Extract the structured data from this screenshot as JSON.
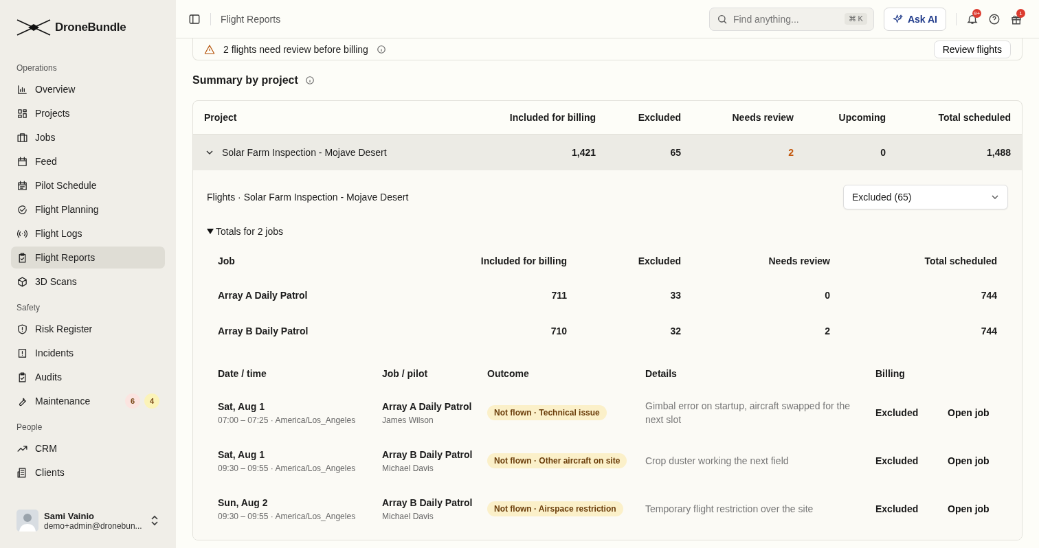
{
  "brand": {
    "name": "DroneBundle"
  },
  "sidebar": {
    "sections": [
      {
        "title": "Operations",
        "items": [
          {
            "label": "Overview",
            "selected": false
          },
          {
            "label": "Projects",
            "selected": false
          },
          {
            "label": "Jobs",
            "selected": false
          },
          {
            "label": "Feed",
            "selected": false
          },
          {
            "label": "Pilot Schedule",
            "selected": false
          },
          {
            "label": "Flight Planning",
            "selected": false
          },
          {
            "label": "Flight Logs",
            "selected": false
          },
          {
            "label": "Flight Reports",
            "selected": true
          },
          {
            "label": "3D Scans",
            "selected": false
          }
        ]
      },
      {
        "title": "Safety",
        "items": [
          {
            "label": "Risk Register",
            "selected": false
          },
          {
            "label": "Incidents",
            "selected": false
          },
          {
            "label": "Audits",
            "selected": false
          },
          {
            "label": "Maintenance",
            "selected": false,
            "badges": [
              {
                "text": "6",
                "color": "#fbe4e0"
              },
              {
                "text": "4",
                "color": "#fbf3b8"
              }
            ]
          }
        ]
      },
      {
        "title": "People",
        "items": [
          {
            "label": "CRM",
            "selected": false
          },
          {
            "label": "Clients",
            "selected": false
          }
        ]
      }
    ],
    "user": {
      "name": "Sami Vainio",
      "email": "demo+admin@dronebun..."
    }
  },
  "topbar": {
    "breadcrumb": "Flight Reports",
    "search": {
      "placeholder": "Find anything...",
      "shortcut": "⌘ K"
    },
    "ask_button": "Ask AI",
    "notifications_badge": "9+",
    "gift_badge": "1"
  },
  "alert": {
    "text": "2 flights need review before billing",
    "button": "Review flights"
  },
  "summary": {
    "title": "Summary by project",
    "columns": [
      "Project",
      "Included for billing",
      "Excluded",
      "Needs review",
      "Upcoming",
      "Total scheduled"
    ],
    "rows": [
      {
        "expanded": true,
        "cells": [
          {
            "text": "Solar Farm Inspection - Mojave Desert",
            "attention": false
          },
          {
            "text": "1,421",
            "attention": false
          },
          {
            "text": "65",
            "attention": false
          },
          {
            "text": "2",
            "attention": true
          },
          {
            "text": "0",
            "attention": false
          },
          {
            "text": "1,488",
            "attention": false
          }
        ]
      }
    ]
  },
  "flights_panel": {
    "title": "Flights · Solar Farm Inspection - Mojave Desert",
    "filter": "Excluded (65)",
    "totals": {
      "label": "Totals for 2 jobs",
      "expanded": true,
      "columns": [
        "Job",
        "Included for billing",
        "Excluded",
        "Needs review",
        "Total scheduled"
      ],
      "rows": [
        [
          "Array A Daily Patrol",
          "711",
          "33",
          "0",
          "744"
        ],
        [
          "Array B Daily Patrol",
          "710",
          "32",
          "2",
          "744"
        ]
      ]
    },
    "columns": [
      "Date / time",
      "Job / pilot",
      "Outcome",
      "Details",
      "Billing"
    ],
    "rows": [
      {
        "date": "Sat, Aug 1",
        "time": "07:00 – 07:25 · America/Los_Angeles",
        "job": "Array A Daily Patrol",
        "pilot": "James Wilson",
        "outcome": "Not flown · Technical issue",
        "details": "Gimbal error on startup, aircraft swapped for the next slot",
        "billing": "Excluded",
        "action": "Open job"
      },
      {
        "date": "Sat, Aug 1",
        "time": "09:30 – 09:55 · America/Los_Angeles",
        "job": "Array B Daily Patrol",
        "pilot": "Michael Davis",
        "outcome": "Not flown · Other aircraft on site",
        "details": "Crop duster working the next field",
        "billing": "Excluded",
        "action": "Open job"
      },
      {
        "date": "Sun, Aug 2",
        "time": "09:30 – 09:55 · America/Los_Angeles",
        "job": "Array B Daily Patrol",
        "pilot": "Michael Davis",
        "outcome": "Not flown · Airspace restriction",
        "details": "Temporary flight restriction over the site",
        "billing": "Excluded",
        "action": "Open job"
      }
    ]
  }
}
